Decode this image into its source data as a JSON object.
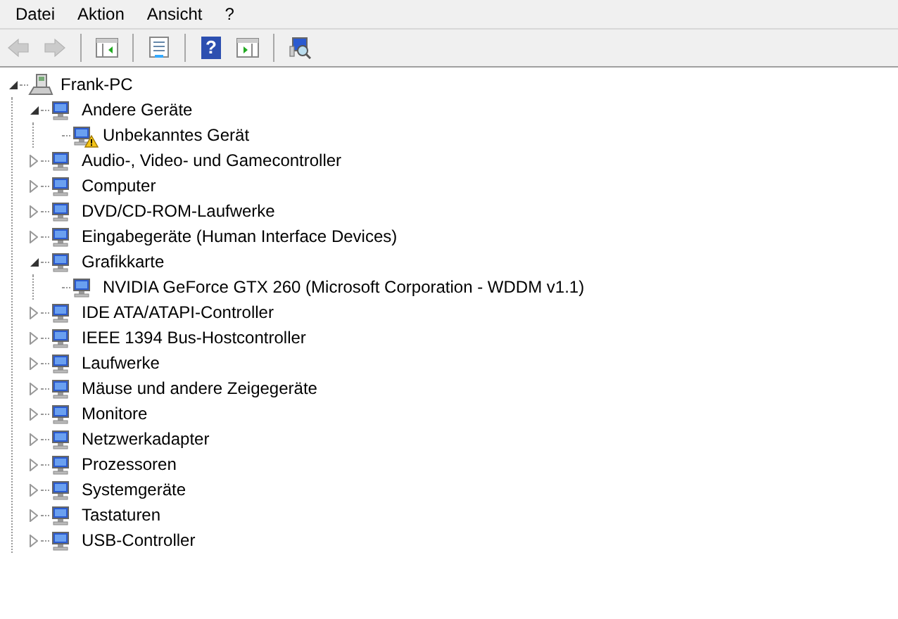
{
  "menu": [
    "Datei",
    "Aktion",
    "Ansicht",
    "?"
  ],
  "toolbar": {
    "buttons": [
      {
        "kind": "back",
        "disabled": true
      },
      {
        "kind": "forward",
        "disabled": true
      },
      {
        "kind": "separator"
      },
      {
        "kind": "console-tree",
        "disabled": false
      },
      {
        "kind": "separator"
      },
      {
        "kind": "properties",
        "disabled": false
      },
      {
        "kind": "separator"
      },
      {
        "kind": "help",
        "disabled": false,
        "text": "?"
      },
      {
        "kind": "action-pane",
        "disabled": false
      },
      {
        "kind": "separator"
      },
      {
        "kind": "scan",
        "disabled": false
      }
    ]
  },
  "tree": {
    "label": "Frank-PC",
    "expanded": true,
    "children": [
      {
        "label": "Andere Geräte",
        "expanded": true,
        "children": [
          {
            "label": "Unbekanntes Gerät",
            "warning": true
          }
        ]
      },
      {
        "label": "Audio-, Video- und Gamecontroller",
        "expanded": false
      },
      {
        "label": "Computer",
        "expanded": false
      },
      {
        "label": "DVD/CD-ROM-Laufwerke",
        "expanded": false
      },
      {
        "label": "Eingabegeräte (Human Interface Devices)",
        "expanded": false
      },
      {
        "label": "Grafikkarte",
        "expanded": true,
        "children": [
          {
            "label": "NVIDIA GeForce GTX 260 (Microsoft Corporation - WDDM v1.1)",
            "warning": false
          }
        ]
      },
      {
        "label": "IDE ATA/ATAPI-Controller",
        "expanded": false
      },
      {
        "label": "IEEE 1394 Bus-Hostcontroller",
        "expanded": false
      },
      {
        "label": "Laufwerke",
        "expanded": false
      },
      {
        "label": "Mäuse und andere Zeigegeräte",
        "expanded": false
      },
      {
        "label": "Monitore",
        "expanded": false
      },
      {
        "label": "Netzwerkadapter",
        "expanded": false
      },
      {
        "label": "Prozessoren",
        "expanded": false
      },
      {
        "label": "Systemgeräte",
        "expanded": false
      },
      {
        "label": "Tastaturen",
        "expanded": false
      },
      {
        "label": "USB-Controller",
        "expanded": false
      }
    ]
  }
}
